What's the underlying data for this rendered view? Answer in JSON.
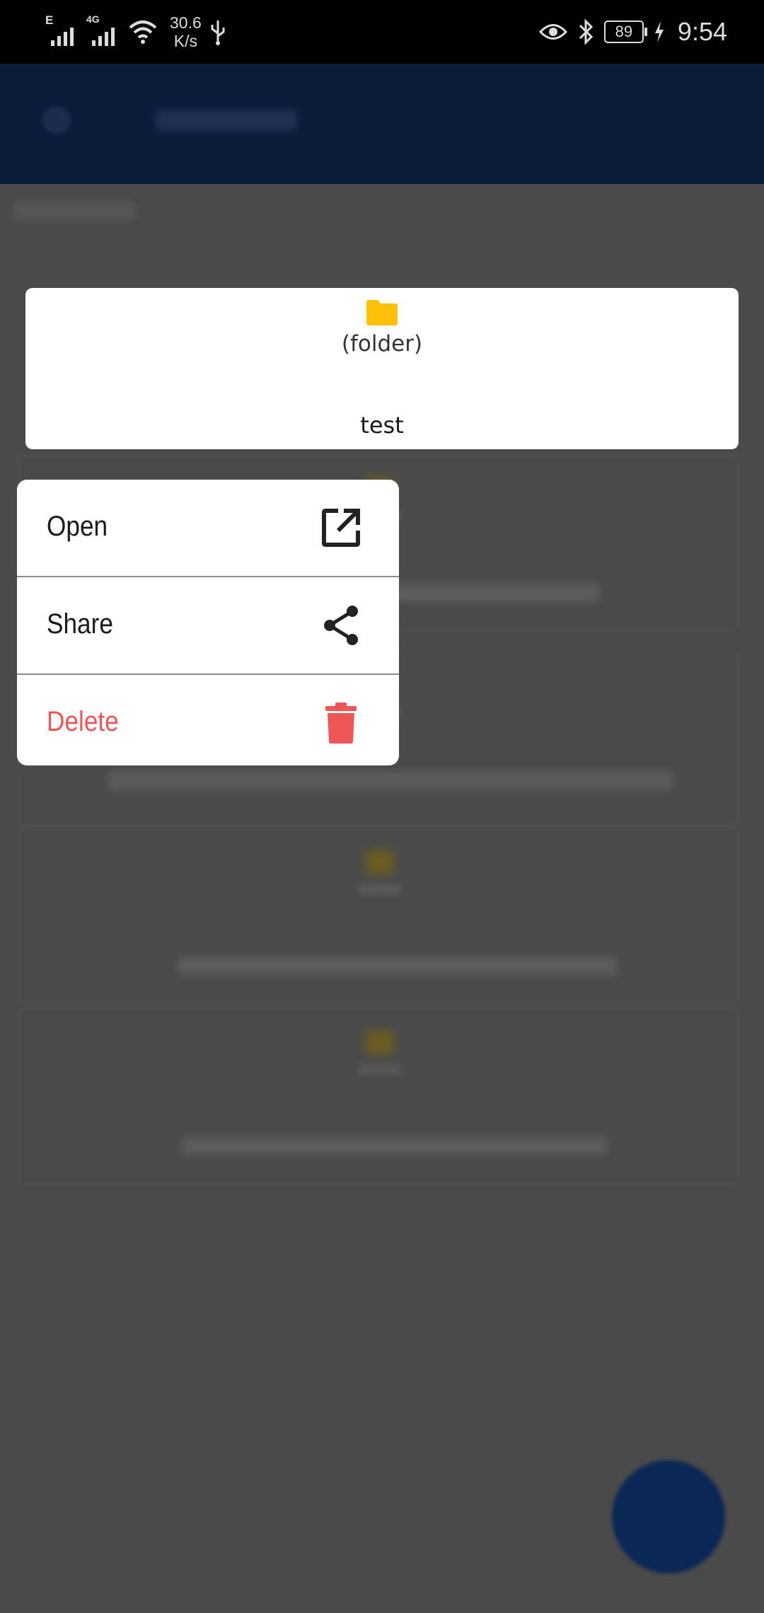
{
  "status_bar": {
    "network_1_tag": "E",
    "network_2_tag": "4G",
    "speed_value": "30.6",
    "speed_unit": "K/s",
    "battery": "89",
    "time": "9:54",
    "icons": [
      "signal-icon",
      "wifi-icon",
      "usb-icon",
      "eye-icon",
      "bluetooth-icon",
      "battery-icon",
      "charging-icon"
    ]
  },
  "selected_item": {
    "icon": "folder-icon",
    "icon_color": "#ffc107",
    "subtitle": "(folder)",
    "name": "test"
  },
  "context_menu": {
    "items": [
      {
        "label": "Open",
        "icon": "open-in-new-icon"
      },
      {
        "label": "Share",
        "icon": "share-icon"
      },
      {
        "label": "Delete",
        "icon": "trash-icon",
        "color": "#f05555"
      }
    ]
  },
  "colors": {
    "app_bar": "#0a1c3a",
    "scrim": "#4a4a4a",
    "danger": "#f05555",
    "folder": "#ffc107"
  }
}
